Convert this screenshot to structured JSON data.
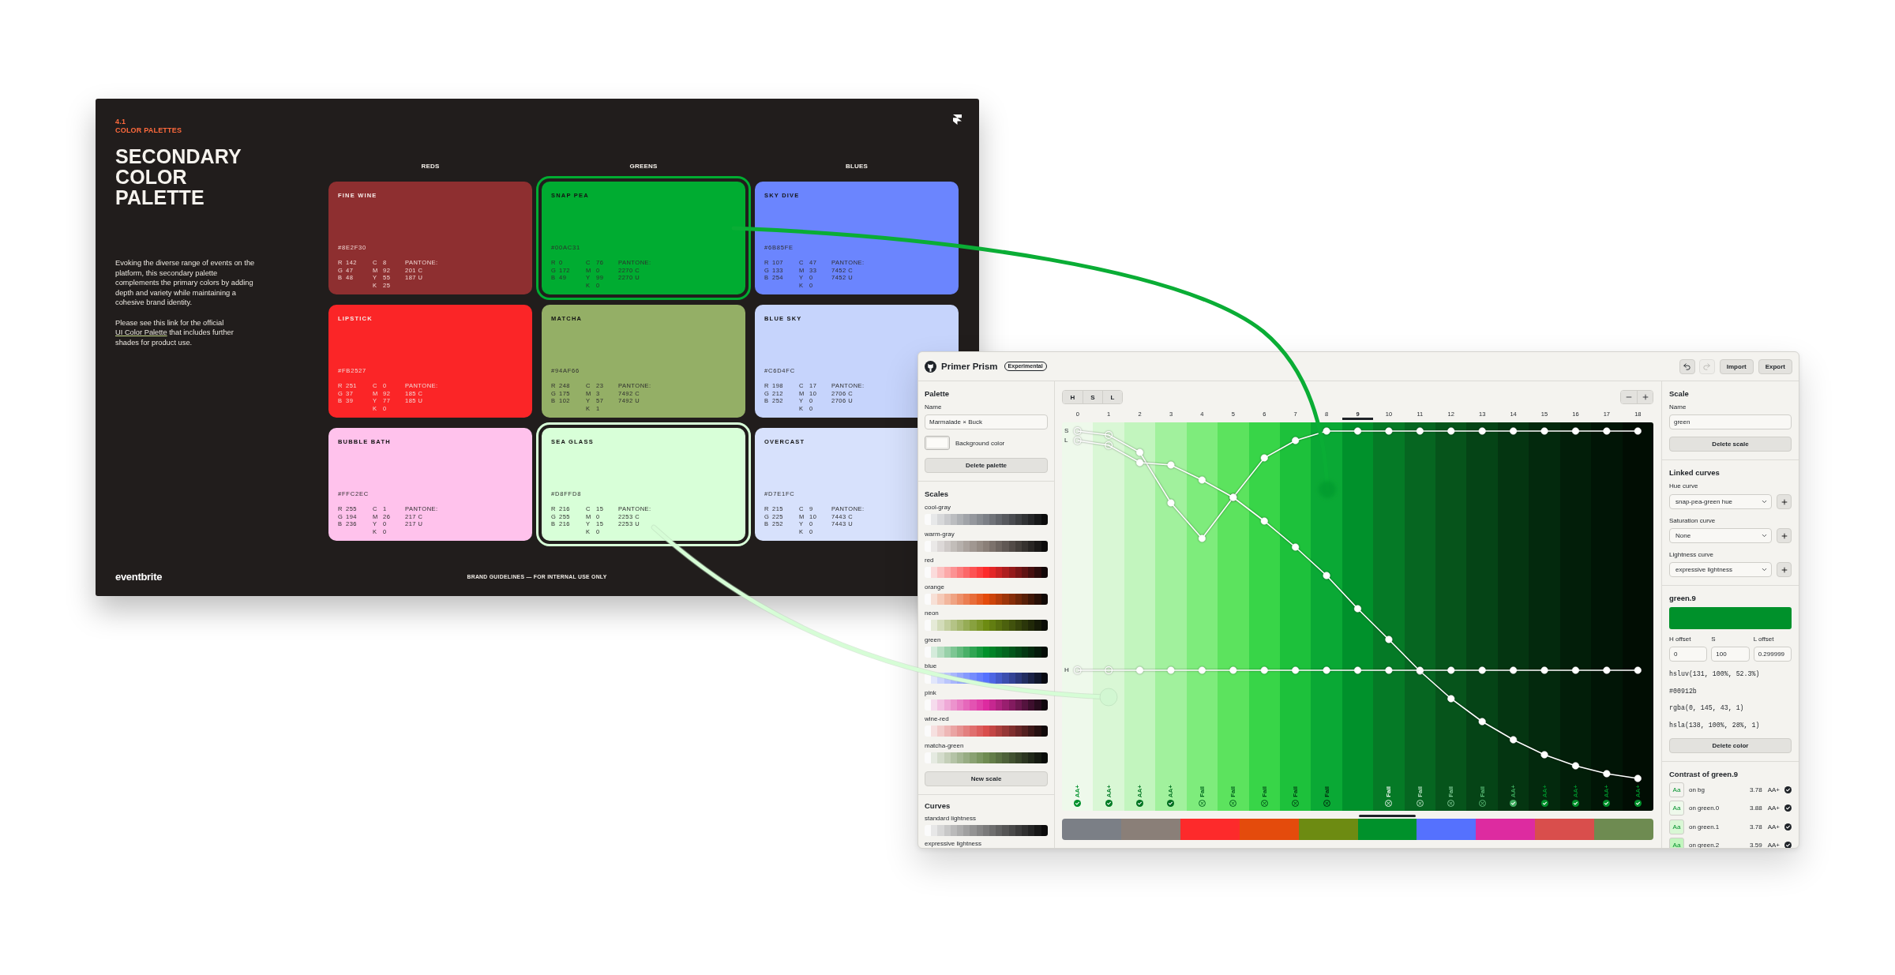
{
  "slide": {
    "section_number": "4.1",
    "section": "COLOR PALETTES",
    "title": "SECONDARY COLOR PALETTE",
    "paragraph": "Evoking the diverse range of events on the platform, this secondary palette complements the primary colors by adding depth and variety while maintaining a cohesive brand identity.",
    "link_paragraph": {
      "before": "Please see this link for the official",
      "link": "UI Color Palette",
      "after": "that includes further shades for product use."
    },
    "columns": [
      {
        "heading": "REDS",
        "cards": [
          {
            "name": "FINE WINE",
            "hex": "#8E2F30",
            "color": "#8e2f30",
            "highlighted": false,
            "rgb": [
              {
                "channel": "R",
                "value": "142"
              },
              {
                "channel": "G",
                "value": "47"
              },
              {
                "channel": "B",
                "value": "48"
              }
            ],
            "cmyk": [
              {
                "channel": "C",
                "value": "8"
              },
              {
                "channel": "M",
                "value": "92"
              },
              {
                "channel": "Y",
                "value": "55"
              },
              {
                "channel": "K",
                "value": "25"
              }
            ],
            "pantone": [
              "PANTONE:",
              "201 C",
              "187 U"
            ]
          },
          {
            "name": "LIPSTICK",
            "hex": "#FB2527",
            "color": "#fb2527",
            "highlighted": false,
            "rgb": [
              {
                "channel": "R",
                "value": "251"
              },
              {
                "channel": "G",
                "value": "37"
              },
              {
                "channel": "B",
                "value": "39"
              }
            ],
            "cmyk": [
              {
                "channel": "C",
                "value": "0"
              },
              {
                "channel": "M",
                "value": "92"
              },
              {
                "channel": "Y",
                "value": "77"
              },
              {
                "channel": "K",
                "value": "0"
              }
            ],
            "pantone": [
              "PANTONE:",
              "185 C",
              "185 U"
            ]
          },
          {
            "name": "BUBBLE BATH",
            "hex": "#FFC2EC",
            "color": "#ffc2ec",
            "highlighted": false,
            "rgb": [
              {
                "channel": "R",
                "value": "255"
              },
              {
                "channel": "G",
                "value": "194"
              },
              {
                "channel": "B",
                "value": "236"
              }
            ],
            "cmyk": [
              {
                "channel": "C",
                "value": "1"
              },
              {
                "channel": "M",
                "value": "26"
              },
              {
                "channel": "Y",
                "value": "0"
              },
              {
                "channel": "K",
                "value": "0"
              }
            ],
            "pantone": [
              "PANTONE:",
              "217 C",
              "217 U"
            ]
          }
        ]
      },
      {
        "heading": "GREENS",
        "cards": [
          {
            "name": "SNAP PEA",
            "hex": "#00AC31",
            "color": "#00ac31",
            "highlighted": true,
            "rgb": [
              {
                "channel": "R",
                "value": "0"
              },
              {
                "channel": "G",
                "value": "172"
              },
              {
                "channel": "B",
                "value": "49"
              }
            ],
            "cmyk": [
              {
                "channel": "C",
                "value": "76"
              },
              {
                "channel": "M",
                "value": "0"
              },
              {
                "channel": "Y",
                "value": "99"
              },
              {
                "channel": "K",
                "value": "0"
              }
            ],
            "pantone": [
              "PANTONE:",
              "2270 C",
              "2270 U"
            ]
          },
          {
            "name": "MATCHA",
            "hex": "#94AF66",
            "color": "#94af66",
            "highlighted": false,
            "rgb": [
              {
                "channel": "R",
                "value": "248"
              },
              {
                "channel": "G",
                "value": "175"
              },
              {
                "channel": "B",
                "value": "102"
              }
            ],
            "cmyk": [
              {
                "channel": "C",
                "value": "23"
              },
              {
                "channel": "M",
                "value": "3"
              },
              {
                "channel": "Y",
                "value": "57"
              },
              {
                "channel": "K",
                "value": "1"
              }
            ],
            "pantone": [
              "PANTONE:",
              "7492 C",
              "7492 U"
            ]
          },
          {
            "name": "SEA GLASS",
            "hex": "#D8FFD8",
            "color": "#d8ffd8",
            "highlighted": true,
            "rgb": [
              {
                "channel": "R",
                "value": "216"
              },
              {
                "channel": "G",
                "value": "255"
              },
              {
                "channel": "B",
                "value": "216"
              }
            ],
            "cmyk": [
              {
                "channel": "C",
                "value": "15"
              },
              {
                "channel": "M",
                "value": "0"
              },
              {
                "channel": "Y",
                "value": "15"
              },
              {
                "channel": "K",
                "value": "0"
              }
            ],
            "pantone": [
              "PANTONE:",
              "2253 C",
              "2253 U"
            ]
          }
        ]
      },
      {
        "heading": "BLUES",
        "cards": [
          {
            "name": "SKY DIVE",
            "hex": "#6B85FE",
            "color": "#6b85fe",
            "highlighted": false,
            "rgb": [
              {
                "channel": "R",
                "value": "107"
              },
              {
                "channel": "G",
                "value": "133"
              },
              {
                "channel": "B",
                "value": "254"
              }
            ],
            "cmyk": [
              {
                "channel": "C",
                "value": "47"
              },
              {
                "channel": "M",
                "value": "33"
              },
              {
                "channel": "Y",
                "value": "0"
              },
              {
                "channel": "K",
                "value": "0"
              }
            ],
            "pantone": [
              "PANTONE:",
              "7452 C",
              "7452 U"
            ]
          },
          {
            "name": "BLUE SKY",
            "hex": "#C6D4FC",
            "color": "#c6d4fc",
            "highlighted": false,
            "rgb": [
              {
                "channel": "R",
                "value": "198"
              },
              {
                "channel": "G",
                "value": "212"
              },
              {
                "channel": "B",
                "value": "252"
              }
            ],
            "cmyk": [
              {
                "channel": "C",
                "value": "17"
              },
              {
                "channel": "M",
                "value": "10"
              },
              {
                "channel": "Y",
                "value": "0"
              },
              {
                "channel": "K",
                "value": "0"
              }
            ],
            "pantone": [
              "PANTONE:",
              "2706 C",
              "2706 U"
            ]
          },
          {
            "name": "OVERCAST",
            "hex": "#D7E1FC",
            "color": "#d7e1fc",
            "highlighted": false,
            "rgb": [
              {
                "channel": "R",
                "value": "215"
              },
              {
                "channel": "G",
                "value": "225"
              },
              {
                "channel": "B",
                "value": "252"
              }
            ],
            "cmyk": [
              {
                "channel": "C",
                "value": "9"
              },
              {
                "channel": "M",
                "value": "10"
              },
              {
                "channel": "Y",
                "value": "0"
              },
              {
                "channel": "K",
                "value": "0"
              }
            ],
            "pantone": [
              "PANTONE:",
              "7443 C",
              "7443 U"
            ]
          }
        ]
      }
    ],
    "logo": "eventbrite",
    "footer": "BRAND GUIDELINES — FOR INTERNAL USE ONLY"
  },
  "app": {
    "title": "Primer Prism",
    "badge": "Experimental",
    "toolbar": [
      {
        "kind": "undo",
        "disabled": false
      },
      {
        "kind": "redo",
        "disabled": true
      },
      {
        "kind": "label",
        "label": "Import",
        "disabled": false
      },
      {
        "kind": "label",
        "label": "Export",
        "disabled": false
      }
    ],
    "palette": {
      "heading": "Palette",
      "name_label": "Name",
      "name": "Marmalade × Buck",
      "background": {
        "label": "Background color",
        "color": "#fcfbf8"
      },
      "delete_button": "Delete palette"
    },
    "scales": {
      "heading": "Scales",
      "items": [
        {
          "name": "cool-gray",
          "color": "#7b7f86",
          "selected": false
        },
        {
          "name": "warm-gray",
          "color": "#8a7f78",
          "selected": false
        },
        {
          "name": "red",
          "color": "#fd2a2b",
          "selected": false
        },
        {
          "name": "orange",
          "color": "#e44b0c",
          "selected": false
        },
        {
          "name": "neon",
          "color": "#6d8b12",
          "selected": false
        },
        {
          "name": "green",
          "color": "#00912b",
          "selected": true
        },
        {
          "name": "blue",
          "color": "#5571fe",
          "selected": false
        },
        {
          "name": "pink",
          "color": "#dd2ba0",
          "selected": false
        },
        {
          "name": "wine-red",
          "color": "#d94e4c",
          "selected": false
        },
        {
          "name": "matcha-green",
          "color": "#6e8b51",
          "selected": false
        }
      ],
      "new_button": "New scale"
    },
    "curves": {
      "heading": "Curves",
      "items": [
        {
          "name": "standard lightness"
        },
        {
          "name": "expressive lightness"
        }
      ]
    },
    "editor": {
      "channel_buttons": [
        "H",
        "S",
        "L"
      ],
      "curve_labels": [
        "S",
        "L",
        "H"
      ],
      "columns": [
        {
          "label": "0",
          "color": "#eef9eb",
          "selected": false,
          "grade": "AA+",
          "pass": true
        },
        {
          "label": "1",
          "color": "#d9f7d5",
          "selected": false,
          "grade": "AA+",
          "pass": true
        },
        {
          "label": "2",
          "color": "#c2f5be",
          "selected": false,
          "grade": "AA+",
          "pass": true
        },
        {
          "label": "3",
          "color": "#a1f19d",
          "selected": false,
          "grade": "AA+",
          "pass": true
        },
        {
          "label": "4",
          "color": "#7eec7c",
          "selected": false,
          "grade": "Fail",
          "pass": false
        },
        {
          "label": "5",
          "color": "#5ce35e",
          "selected": false,
          "grade": "Fail",
          "pass": false
        },
        {
          "label": "6",
          "color": "#38d548",
          "selected": false,
          "grade": "Fail",
          "pass": false
        },
        {
          "label": "7",
          "color": "#1dc13b",
          "selected": false,
          "grade": "Fail",
          "pass": false
        },
        {
          "label": "8",
          "color": "#0aa935",
          "selected": false,
          "grade": "Fail",
          "pass": false
        },
        {
          "label": "9",
          "color": "#00912b",
          "selected": true
        },
        {
          "label": "10",
          "color": "#057a26",
          "selected": false,
          "grade": "Fail",
          "pass": false
        },
        {
          "label": "11",
          "color": "#066621",
          "selected": false,
          "grade": "Fail",
          "pass": false
        },
        {
          "label": "12",
          "color": "#06541b",
          "selected": false,
          "grade": "Fail",
          "pass": false
        },
        {
          "label": "13",
          "color": "#054416",
          "selected": false,
          "grade": "Fail",
          "pass": false
        },
        {
          "label": "14",
          "color": "#043511",
          "selected": false,
          "grade": "AA+",
          "pass": true
        },
        {
          "label": "15",
          "color": "#03290d",
          "selected": false,
          "grade": "AA+",
          "pass": true
        },
        {
          "label": "16",
          "color": "#021e09",
          "selected": false,
          "grade": "AA+",
          "pass": true
        },
        {
          "label": "17",
          "color": "#011506",
          "selected": false,
          "grade": "AA+",
          "pass": true
        },
        {
          "label": "18",
          "color": "#010d03",
          "selected": false,
          "grade": "AA+",
          "pass": true
        }
      ]
    },
    "scale": {
      "heading": "Scale",
      "name_label": "Name",
      "name": "green",
      "delete_button": "Delete scale"
    },
    "linked_curves": {
      "heading": "Linked curves",
      "items": [
        {
          "label": "Hue curve",
          "value": "snap-pea-green hue"
        },
        {
          "label": "Saturation curve",
          "value": "None"
        },
        {
          "label": "Lightness curve",
          "value": "expressive lightness"
        }
      ]
    },
    "color": {
      "heading": "green.9",
      "color": "#00912b",
      "fields": [
        {
          "label": "H offset",
          "value": "0"
        },
        {
          "label": "S",
          "value": "100"
        },
        {
          "label": "L offset",
          "value": "0.299999"
        }
      ],
      "formats": [
        "hsluv(131, 100%, 52.3%)",
        "#00912b",
        "rgba(0, 145, 43, 1)",
        "hsla(138, 100%, 28%, 1)"
      ],
      "delete_button": "Delete color"
    },
    "contrast": {
      "heading": "Contrast of green.9",
      "rows": [
        {
          "sample": "Aa",
          "label": "on bg",
          "ratio": "3.78",
          "grade": "AA+",
          "pass": true,
          "color": "#f4f3ef"
        },
        {
          "sample": "Aa",
          "label": "on green.0",
          "ratio": "3.88",
          "grade": "AA+",
          "pass": true,
          "color": "#eef9eb"
        },
        {
          "sample": "Aa",
          "label": "on green.1",
          "ratio": "3.78",
          "grade": "AA+",
          "pass": true,
          "color": "#d9f7d5"
        },
        {
          "sample": "Aa",
          "label": "on green.2",
          "ratio": "3.59",
          "grade": "AA+",
          "pass": true,
          "color": "#c2f5be"
        }
      ]
    }
  }
}
